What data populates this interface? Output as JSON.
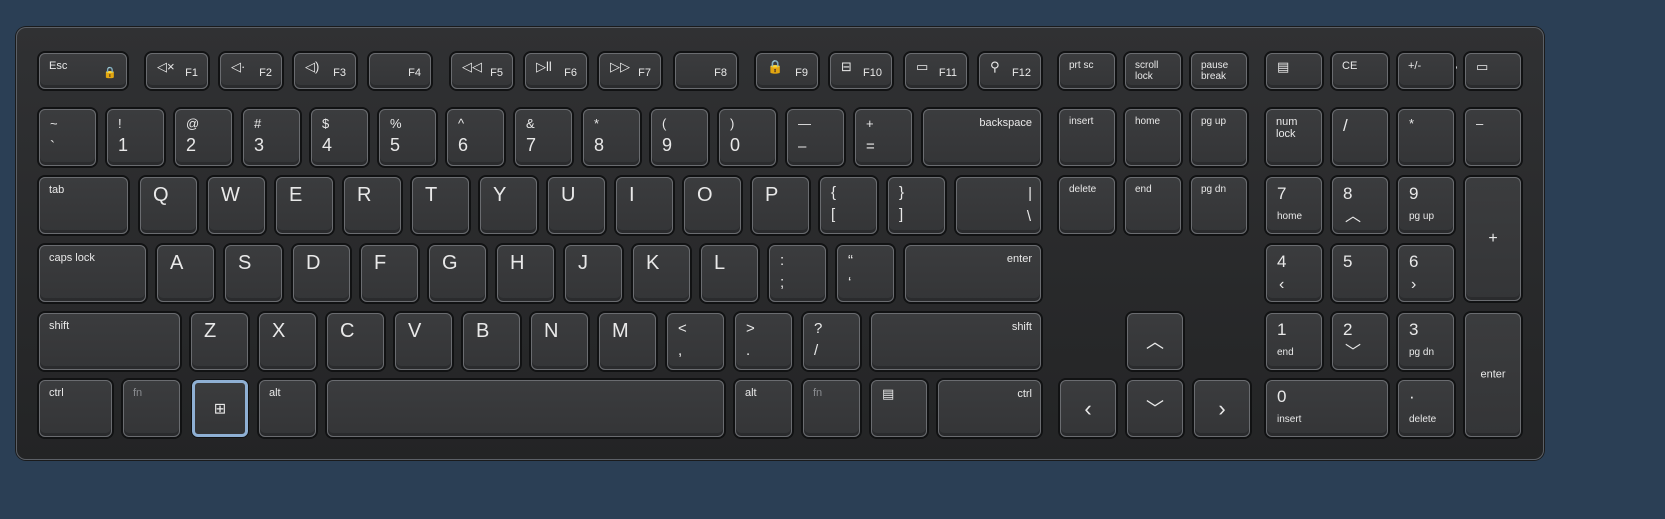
{
  "keyboard": {
    "function_row": {
      "esc": "Esc",
      "f1": "F1",
      "f2": "F2",
      "f3": "F3",
      "f4": "F4",
      "f5": "F5",
      "f6": "F6",
      "f7": "F7",
      "f8": "F8",
      "f9": "F9",
      "f10": "F10",
      "f11": "F11",
      "f12": "F12",
      "prtsc": "prt sc",
      "scroll": "scroll\nlock",
      "pause": "pause\nbreak",
      "ce": "CE",
      "plusminus": "+/-"
    },
    "number_row": {
      "tilde": "~",
      "backtick": "`",
      "1a": "!",
      "1": "1",
      "2a": "@",
      "2": "2",
      "3a": "#",
      "3": "3",
      "4a": "$",
      "4": "4",
      "5a": "%",
      "5": "5",
      "6a": "^",
      "6": "6",
      "7a": "&",
      "7": "7",
      "8a": "*",
      "8": "8",
      "9a": "(",
      "9": "9",
      "0a": ")",
      "0": "0",
      "minus_top": "—",
      "minus_bot": "–",
      "eq_top": "+",
      "eq_bot": "=",
      "backspace": "backspace",
      "insert": "insert",
      "home": "home",
      "pgup": "pg up",
      "numlock": "num\nlock",
      "divide": "/",
      "multiply": "*",
      "subtract": "–"
    },
    "q_row": {
      "tab": "tab",
      "q": "Q",
      "w": "W",
      "e": "E",
      "r": "R",
      "t": "T",
      "y": "Y",
      "u": "U",
      "i": "I",
      "o": "O",
      "p": "P",
      "lbrace": "{",
      "lbracket": "[",
      "rbrace": "}",
      "rbracket": "]",
      "pipe": "|",
      "backslash": "\\",
      "delete": "delete",
      "end": "end",
      "pgdn": "pg dn",
      "n7": "7",
      "n7b": "home",
      "n8": "8",
      "n9": "9",
      "n9b": "pg up",
      "plus": "+"
    },
    "a_row": {
      "caps": "caps lock",
      "a": "A",
      "s": "S",
      "d": "D",
      "f": "F",
      "g": "G",
      "h": "H",
      "j": "J",
      "k": "K",
      "l": "L",
      "colon": ":",
      "semicolon": ";",
      "quote_top": "“",
      "quote_bot": "‘",
      "enter": "enter",
      "n4": "4",
      "n5": "5",
      "n6": "6"
    },
    "z_row": {
      "shift": "shift",
      "z": "Z",
      "x": "X",
      "c": "C",
      "v": "V",
      "b": "B",
      "n": "N",
      "m": "M",
      "lt": "<",
      "comma": ",",
      "gt": ">",
      "period": ".",
      "question": "?",
      "slash": "/",
      "rshift": "shift",
      "n1": "1",
      "n1b": "end",
      "n2": "2",
      "n3": "3",
      "n3b": "pg dn",
      "numenter": "enter"
    },
    "bottom_row": {
      "ctrl": "ctrl",
      "fn": "fn",
      "alt": "alt",
      "ralt": "alt",
      "rfn": "fn",
      "rctrl": "ctrl",
      "n0": "0",
      "n0b": "insert",
      "ndot": "·",
      "ndotb": "delete"
    }
  }
}
